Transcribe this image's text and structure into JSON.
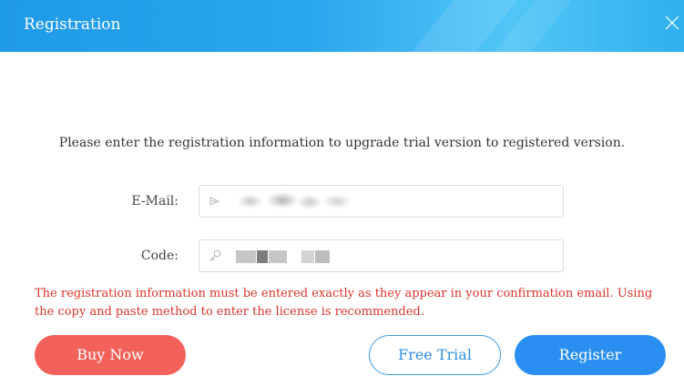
{
  "window": {
    "title": "Registration",
    "close_icon": "close-icon"
  },
  "instruction": "Please enter the registration information to upgrade trial version to registered version.",
  "form": {
    "email_label": "E-Mail:",
    "email_value": "",
    "email_icon": "mail-icon",
    "code_label": "Code:",
    "code_value": "",
    "code_icon": "key-icon"
  },
  "warning": "The registration information must be entered exactly as they appear in your confirmation email. Using the copy and paste method to enter the license is recommended.",
  "buttons": {
    "buy_now": "Buy Now",
    "free_trial": "Free Trial",
    "register": "Register"
  },
  "colors": {
    "title_bar": "#2aa6ee",
    "warning_text": "#d9342b",
    "buy_button": "#f2625b",
    "register_button": "#2a8ff0",
    "trial_border": "#3b9be6"
  }
}
